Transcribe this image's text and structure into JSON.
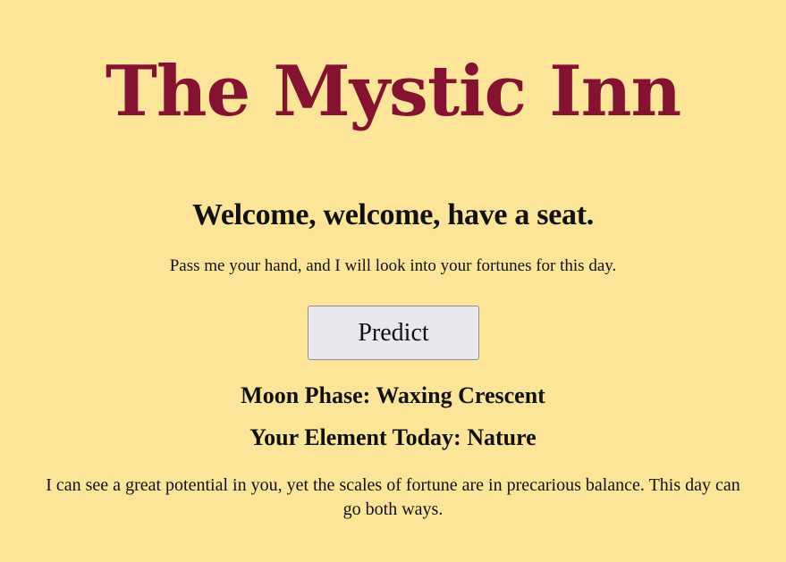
{
  "header": {
    "title": "The Mystic Inn"
  },
  "main": {
    "welcome": "Welcome, welcome, have a seat.",
    "intro": "Pass me your hand, and I will look into your fortunes for this day.",
    "predict_label": "Predict",
    "moon_phase": "Moon Phase: Waxing Crescent",
    "element": "Your Element Today: Nature",
    "fortune": "I can see a great potential in you, yet the scales of fortune are in precarious balance. This day can go both ways."
  },
  "colors": {
    "background": "#fce499",
    "title": "#861231",
    "button": "#e9e8ee"
  }
}
